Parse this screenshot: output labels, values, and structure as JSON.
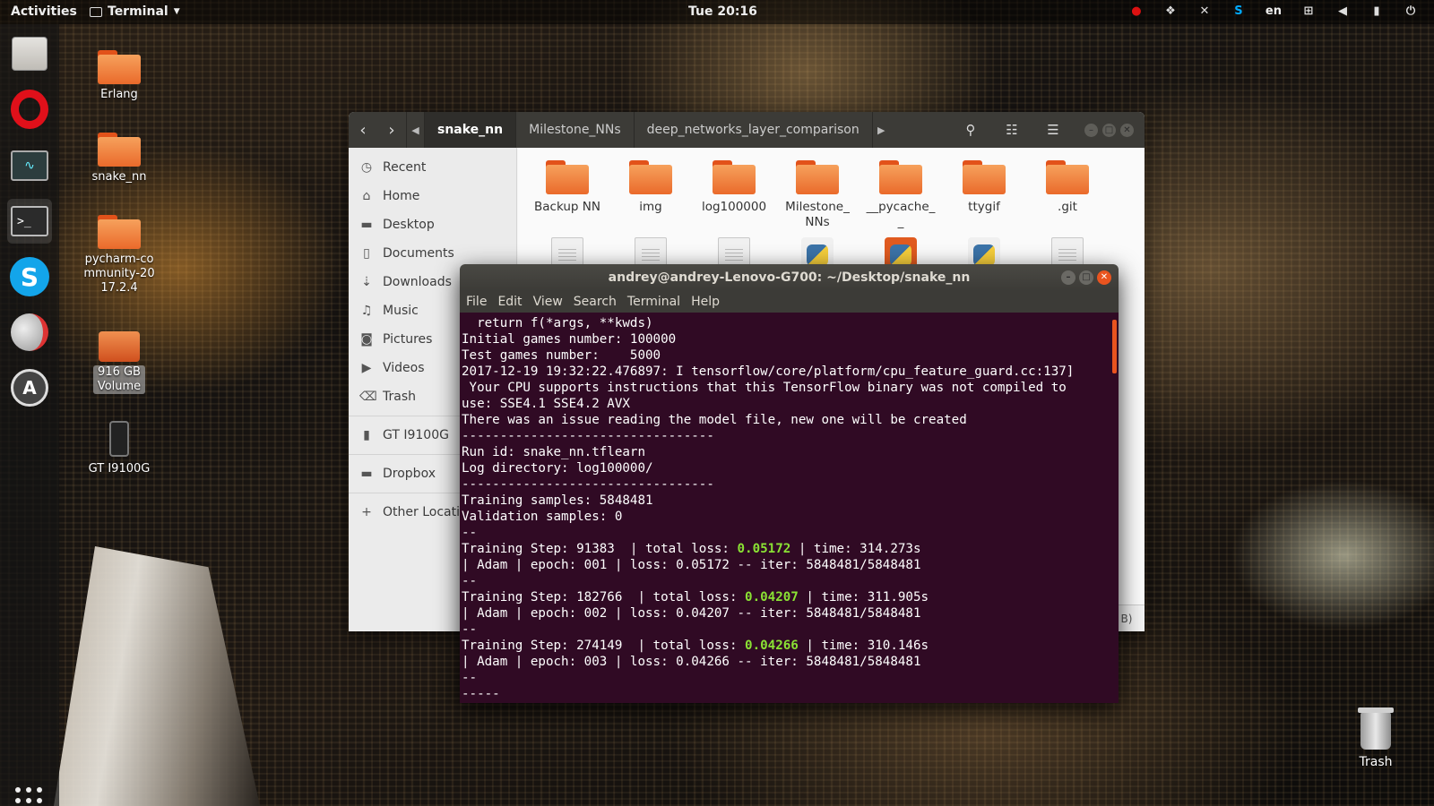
{
  "topbar": {
    "activities": "Activities",
    "app_name": "Terminal",
    "clock": "Tue 20:16",
    "language": "en",
    "tray_icons": [
      "opera-icon",
      "dropbox-icon",
      "close-icon",
      "skype-icon",
      "language-icon",
      "network-icon",
      "volume-icon",
      "battery-icon",
      "power-icon"
    ]
  },
  "dock": {
    "apps": [
      "files-icon",
      "opera-icon",
      "system-monitor-icon",
      "terminal-icon",
      "skype-icon",
      "disk-usage-icon",
      "software-updater-icon"
    ],
    "show_apps": "apps-grid-icon"
  },
  "desktop": {
    "icons": [
      {
        "label": "Erlang"
      },
      {
        "label": "snake_nn"
      },
      {
        "label": "pycharm-community-2017.2.4"
      },
      {
        "label": "916 GB Volume"
      },
      {
        "label": "GT I9100G"
      }
    ],
    "trash_label": "Trash"
  },
  "file_manager": {
    "breadcrumbs": [
      "snake_nn",
      "Milestone_NNs",
      "deep_networks_layer_comparison"
    ],
    "sidebar": [
      {
        "label": "Recent",
        "icon": "clock-icon"
      },
      {
        "label": "Home",
        "icon": "home-icon"
      },
      {
        "label": "Desktop",
        "icon": "folder-icon"
      },
      {
        "label": "Documents",
        "icon": "document-icon"
      },
      {
        "label": "Downloads",
        "icon": "download-icon"
      },
      {
        "label": "Music",
        "icon": "music-icon"
      },
      {
        "label": "Pictures",
        "icon": "camera-icon"
      },
      {
        "label": "Videos",
        "icon": "video-icon"
      },
      {
        "label": "Trash",
        "icon": "trash-icon"
      },
      {
        "label": "GT I9100G",
        "icon": "phone-icon"
      },
      {
        "label": "Dropbox",
        "icon": "folder-icon"
      },
      {
        "label": "Other Locations",
        "icon": "plus-icon"
      }
    ],
    "folders": [
      {
        "label": "Backup NN"
      },
      {
        "label": "img"
      },
      {
        "label": "log100000"
      },
      {
        "label": "Milestone_ NNs"
      },
      {
        "label": "__pycache_ _"
      },
      {
        "label": "ttygif"
      },
      {
        "label": ".git"
      }
    ],
    "status_fragment": "B)"
  },
  "terminal": {
    "title": "andrey@andrey-Lenovo-G700: ~/Desktop/snake_nn",
    "menu": [
      "File",
      "Edit",
      "View",
      "Search",
      "Terminal",
      "Help"
    ],
    "lines": [
      {
        "text": "  return f(*args, **kwds)"
      },
      {
        "text": "Initial games number: 100000"
      },
      {
        "text": "Test games number:    5000"
      },
      {
        "text": "2017-12-19 19:32:22.476897: I tensorflow/core/platform/cpu_feature_guard.cc:137]"
      },
      {
        "text": " Your CPU supports instructions that this TensorFlow binary was not compiled to"
      },
      {
        "text": "use: SSE4.1 SSE4.2 AVX"
      },
      {
        "text": "There was an issue reading the model file, new one will be created"
      },
      {
        "text": "---------------------------------"
      },
      {
        "text": "Run id: snake_nn.tflearn"
      },
      {
        "text": "Log directory: log100000/"
      },
      {
        "text": "---------------------------------"
      },
      {
        "text": "Training samples: 5848481"
      },
      {
        "text": "Validation samples: 0"
      },
      {
        "text": "--"
      },
      {
        "text": "Training Step: 91383  | total loss: ",
        "hl": "0.05172",
        "after": " | time: 314.273s"
      },
      {
        "text": "| Adam | epoch: 001 | loss: 0.05172 -- iter: 5848481/5848481"
      },
      {
        "text": "--"
      },
      {
        "text": "Training Step: 182766  | total loss: ",
        "hl": "0.04207",
        "after": " | time: 311.905s"
      },
      {
        "text": "| Adam | epoch: 002 | loss: 0.04207 -- iter: 5848481/5848481"
      },
      {
        "text": "--"
      },
      {
        "text": "Training Step: 274149  | total loss: ",
        "hl": "0.04266",
        "after": " | time: 310.146s"
      },
      {
        "text": "| Adam | epoch: 003 | loss: 0.04266 -- iter: 5848481/5848481"
      },
      {
        "text": "--"
      },
      {
        "text": "-----"
      }
    ]
  },
  "colors": {
    "terminal_bg": "#300a24",
    "accent": "#e9541f",
    "highlight": "#8ae234"
  }
}
